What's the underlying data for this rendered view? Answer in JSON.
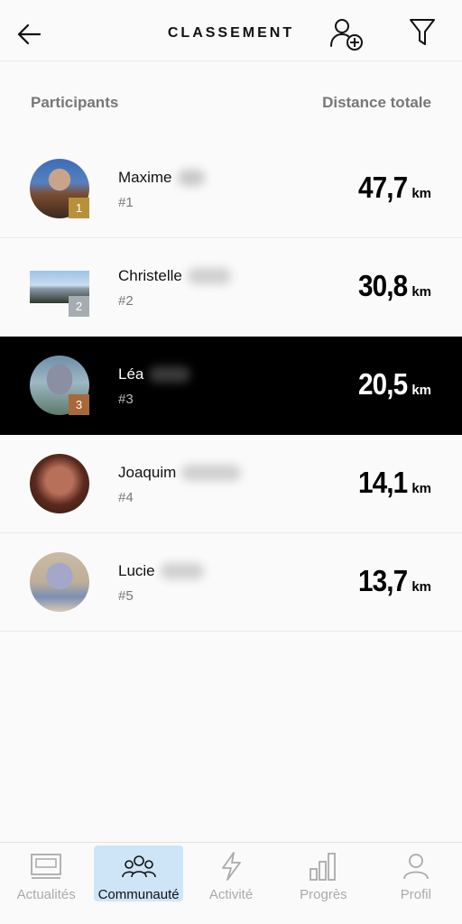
{
  "header": {
    "title": "CLASSEMENT",
    "back_icon": "arrow-left-icon",
    "add_icon": "add-user-icon",
    "filter_icon": "filter-icon"
  },
  "columns": {
    "left": "Participants",
    "right": "Distance totale"
  },
  "ranking": [
    {
      "name": "Maxime",
      "rank": "#1",
      "badge": "1",
      "badge_color": "#b8903a",
      "distance": "47,7",
      "unit": "km",
      "highlight": false
    },
    {
      "name": "Christelle",
      "rank": "#2",
      "badge": "2",
      "badge_color": "#a7abb2",
      "distance": "30,8",
      "unit": "km",
      "highlight": false
    },
    {
      "name": "Léa",
      "rank": "#3",
      "badge": "3",
      "badge_color": "#a8683a",
      "distance": "20,5",
      "unit": "km",
      "highlight": true
    },
    {
      "name": "Joaquim",
      "rank": "#4",
      "badge": "",
      "badge_color": "",
      "distance": "14,1",
      "unit": "km",
      "highlight": false
    },
    {
      "name": "Lucie",
      "rank": "#5",
      "badge": "",
      "badge_color": "",
      "distance": "13,7",
      "unit": "km",
      "highlight": false
    }
  ],
  "tabs": [
    {
      "label": "Actualités",
      "icon": "news-icon",
      "active": false
    },
    {
      "label": "Communauté",
      "icon": "community-icon",
      "active": true
    },
    {
      "label": "Activité",
      "icon": "lightning-icon",
      "active": false
    },
    {
      "label": "Progrès",
      "icon": "bar-chart-icon",
      "active": false
    },
    {
      "label": "Profil",
      "icon": "profile-icon",
      "active": false
    }
  ],
  "colors": {
    "accent_active_tab": "#cde5f7",
    "highlight_row": "#000000"
  }
}
